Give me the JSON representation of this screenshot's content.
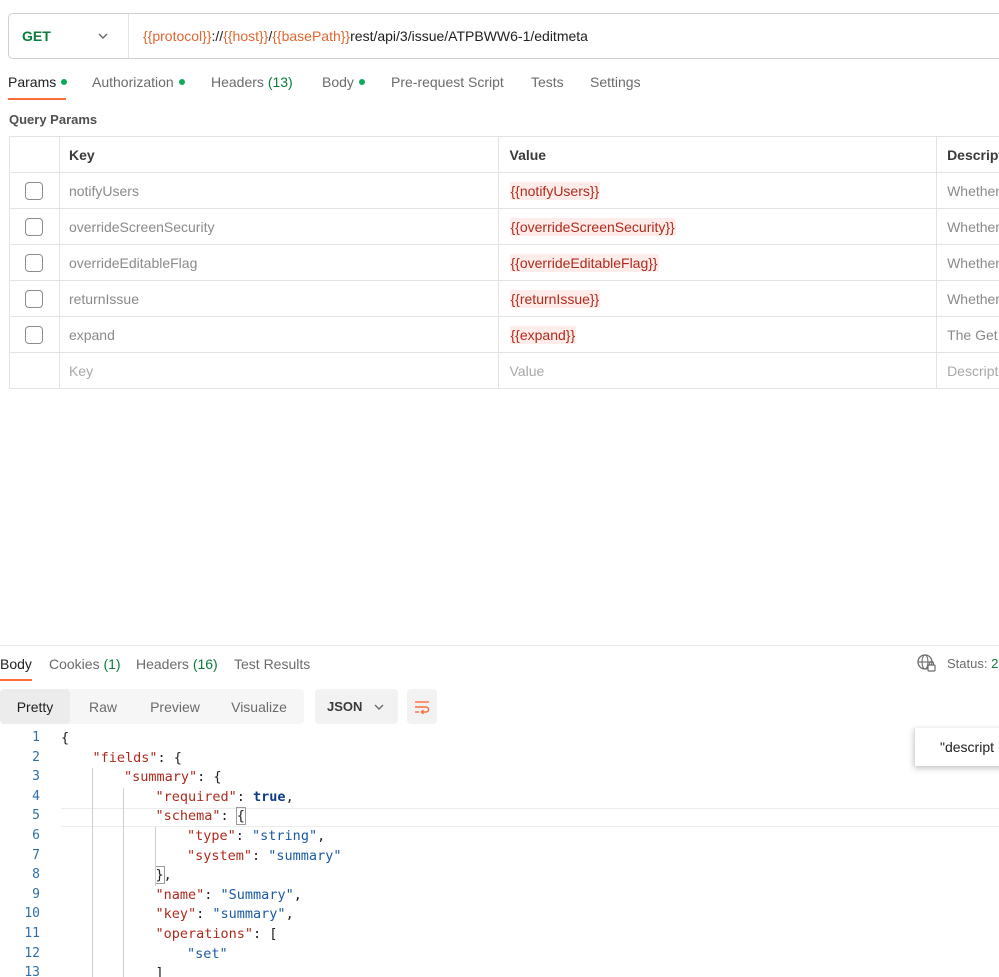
{
  "request": {
    "method": "GET",
    "url_parts": [
      {
        "text": "{{protocol}}",
        "var": true
      },
      {
        "text": "://",
        "var": false
      },
      {
        "text": "{{host}}",
        "var": true
      },
      {
        "text": "/",
        "var": false
      },
      {
        "text": "{{basePath}}",
        "var": true
      },
      {
        "text": "rest/api/3/issue/ATPBWW6-1/editmeta",
        "var": false
      }
    ]
  },
  "tabs": {
    "params": "Params",
    "authorization": "Authorization",
    "headers": "Headers",
    "headers_count": "(13)",
    "body": "Body",
    "prerequest": "Pre-request Script",
    "tests": "Tests",
    "settings": "Settings"
  },
  "query_params": {
    "title": "Query Params",
    "headers": {
      "key": "Key",
      "value": "Value",
      "description": "Descript"
    },
    "rows": [
      {
        "key": "notifyUsers",
        "value": "{{notifyUsers}}",
        "description": "Whether"
      },
      {
        "key": "overrideScreenSecurity",
        "value": "{{overrideScreenSecurity}}",
        "description": "Whether"
      },
      {
        "key": "overrideEditableFlag",
        "value": "{{overrideEditableFlag}}",
        "description": "Whether"
      },
      {
        "key": "returnIssue",
        "value": "{{returnIssue}}",
        "description": "Whether"
      },
      {
        "key": "expand",
        "value": "{{expand}}",
        "description": "The Get"
      }
    ],
    "placeholder": {
      "key": "Key",
      "value": "Value",
      "description": "Descript"
    }
  },
  "response": {
    "tabs": {
      "body": "Body",
      "cookies": "Cookies",
      "cookies_count": "(1)",
      "headers": "Headers",
      "headers_count": "(16)",
      "test_results": "Test Results"
    },
    "status_label": "Status:",
    "status_value": "2",
    "views": [
      "Pretty",
      "Raw",
      "Preview",
      "Visualize"
    ],
    "format": "JSON",
    "popup_text": "\"descript",
    "code_lines": [
      {
        "n": "1",
        "indent": 0,
        "tokens": [
          {
            "t": "{",
            "c": ""
          }
        ]
      },
      {
        "n": "2",
        "indent": 1,
        "tokens": [
          {
            "t": "\"fields\"",
            "c": "k"
          },
          {
            "t": ": {",
            "c": ""
          }
        ]
      },
      {
        "n": "3",
        "indent": 2,
        "tokens": [
          {
            "t": "\"summary\"",
            "c": "k"
          },
          {
            "t": ": {",
            "c": ""
          }
        ]
      },
      {
        "n": "4",
        "indent": 3,
        "tokens": [
          {
            "t": "\"required\"",
            "c": "k"
          },
          {
            "t": ": ",
            "c": ""
          },
          {
            "t": "true",
            "c": "b"
          },
          {
            "t": ",",
            "c": ""
          }
        ]
      },
      {
        "n": "5",
        "indent": 3,
        "tokens": [
          {
            "t": "\"schema\"",
            "c": "k"
          },
          {
            "t": ": ",
            "c": ""
          },
          {
            "t": "{",
            "c": "hl"
          }
        ]
      },
      {
        "n": "6",
        "indent": 4,
        "tokens": [
          {
            "t": "\"type\"",
            "c": "k"
          },
          {
            "t": ": ",
            "c": ""
          },
          {
            "t": "\"string\"",
            "c": "s"
          },
          {
            "t": ",",
            "c": ""
          }
        ]
      },
      {
        "n": "7",
        "indent": 4,
        "tokens": [
          {
            "t": "\"system\"",
            "c": "k"
          },
          {
            "t": ": ",
            "c": ""
          },
          {
            "t": "\"summary\"",
            "c": "s"
          }
        ]
      },
      {
        "n": "8",
        "indent": 3,
        "tokens": [
          {
            "t": "}",
            "c": "hl"
          },
          {
            "t": ",",
            "c": ""
          }
        ]
      },
      {
        "n": "9",
        "indent": 3,
        "tokens": [
          {
            "t": "\"name\"",
            "c": "k"
          },
          {
            "t": ": ",
            "c": ""
          },
          {
            "t": "\"Summary\"",
            "c": "s"
          },
          {
            "t": ",",
            "c": ""
          }
        ]
      },
      {
        "n": "10",
        "indent": 3,
        "tokens": [
          {
            "t": "\"key\"",
            "c": "k"
          },
          {
            "t": ": ",
            "c": ""
          },
          {
            "t": "\"summary\"",
            "c": "s"
          },
          {
            "t": ",",
            "c": ""
          }
        ]
      },
      {
        "n": "11",
        "indent": 3,
        "tokens": [
          {
            "t": "\"operations\"",
            "c": "k"
          },
          {
            "t": ": [",
            "c": ""
          }
        ]
      },
      {
        "n": "12",
        "indent": 4,
        "tokens": [
          {
            "t": "\"set\"",
            "c": "s"
          }
        ]
      },
      {
        "n": "13",
        "indent": 3,
        "tokens": [
          {
            "t": "]",
            "c": ""
          }
        ]
      }
    ]
  },
  "colors": {
    "accent": "#ff6c37",
    "method_get": "#0a7d39",
    "variable": "#e0662e",
    "json_key": "#b0291d",
    "json_string": "#1a5aa6"
  }
}
